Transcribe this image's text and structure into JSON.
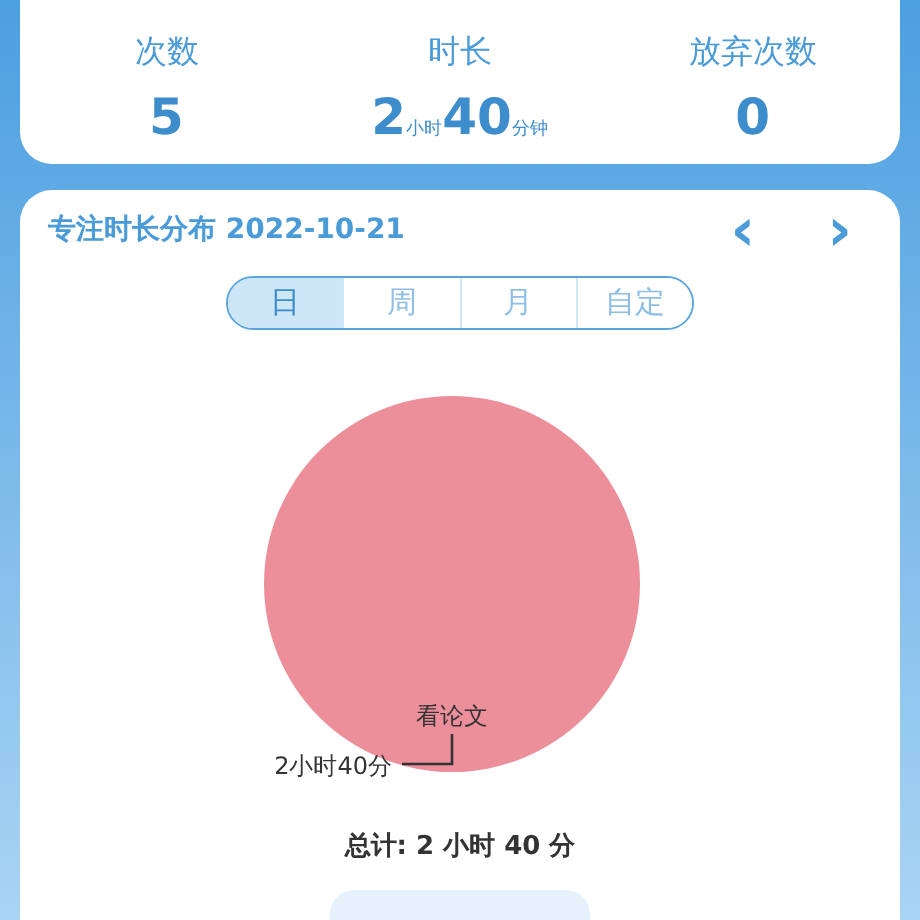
{
  "summary": {
    "stats": [
      {
        "label": "次数",
        "value": [
          {
            "kind": "big",
            "text": "5"
          }
        ]
      },
      {
        "label": "时长",
        "value": [
          {
            "kind": "big",
            "text": "2"
          },
          {
            "kind": "unit",
            "text": "小时"
          },
          {
            "kind": "big",
            "text": "40"
          },
          {
            "kind": "unit",
            "text": "分钟"
          }
        ]
      },
      {
        "label": "放弃次数",
        "value": [
          {
            "kind": "big",
            "text": "0"
          }
        ]
      }
    ]
  },
  "distribution": {
    "title": "专注时长分布 2022-10-21",
    "prev": "‹",
    "next": "›",
    "tabs": [
      {
        "label": "日",
        "selected": true
      },
      {
        "label": "周",
        "selected": false
      },
      {
        "label": "月",
        "selected": false
      },
      {
        "label": "自定",
        "selected": false
      }
    ],
    "chart_data": {
      "type": "pie",
      "categories": [
        "看论文"
      ],
      "annotations": [
        "2小时40分"
      ]
    },
    "total": "总计: 2 小时 40 分"
  }
}
